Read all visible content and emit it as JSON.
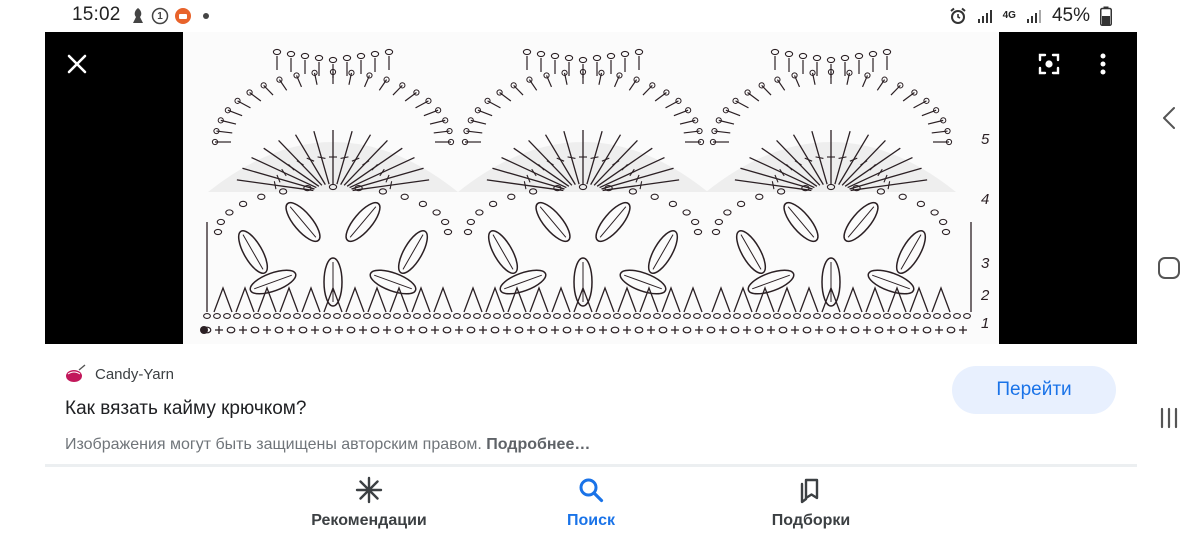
{
  "status_bar": {
    "time": "15:02",
    "notification_count": "1",
    "network_type": "4G",
    "battery": "45%"
  },
  "viewer": {
    "row_numbers": [
      "5",
      "4",
      "3",
      "2",
      "1"
    ]
  },
  "result": {
    "source_name": "Candy-Yarn",
    "title": "Как вязать кайму крючком?",
    "copyright_text": "Изображения могут быть защищены авторским правом.",
    "more_link": "Подробнее…",
    "visit_button": "Перейти"
  },
  "bottom_nav": {
    "items": [
      {
        "label": "Рекомендации",
        "icon": "sparkle-icon"
      },
      {
        "label": "Поиск",
        "icon": "search-icon",
        "active": true
      },
      {
        "label": "Подборки",
        "icon": "collections-icon"
      }
    ]
  },
  "colors": {
    "accent": "#1a73e8",
    "button_bg": "#e8f0fe",
    "viewer_bg": "#000000",
    "pattern_ink": "#2b2024"
  }
}
